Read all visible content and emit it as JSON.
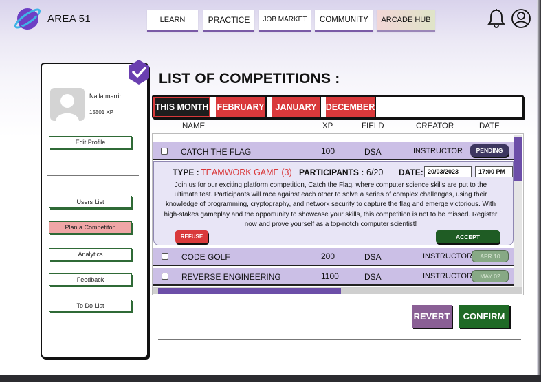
{
  "header": {
    "brand": "AREA 51",
    "nav": [
      "LEARN",
      "PRACTICE",
      "JOB MARKET",
      "COMMUNITY",
      "ARCADE HUB"
    ]
  },
  "sidebar": {
    "profile": {
      "name": "Naila marrir",
      "xp": "15501 XP"
    },
    "edit_profile": "Edit Profile",
    "items": [
      "Users List",
      "Plan a Competiton",
      "Analytics",
      "Feedback",
      "To Do List"
    ],
    "active_item": "Plan a Competiton"
  },
  "main": {
    "title": "LIST OF COMPETITIONS :",
    "tabs": [
      "THIS MONTH",
      "FEBRUARY",
      "JANUARY",
      "DECEMBER"
    ],
    "active_tab": "THIS MONTH",
    "columns": [
      "NAME",
      "XP",
      "FIELD",
      "CREATOR",
      "DATE"
    ],
    "rows": [
      {
        "name": "CATCH THE FLAG",
        "xp": "100",
        "field": "DSA",
        "creator": "INSTRUCTOR",
        "date": "PENDING"
      },
      {
        "name": "CODE GOLF",
        "xp": "200",
        "field": "DSA",
        "creator": "INSTRUCTOR",
        "date": "APR 10"
      },
      {
        "name": "REVERSE ENGINEERING",
        "xp": "1100",
        "field": "DSA",
        "creator": "INSTRUCTOR",
        "date": "MAY 02"
      }
    ],
    "detail": {
      "type_label": "TYPE :",
      "type_value": "TEAMWORK GAME (3)",
      "participants_label": "PARTICIPANTS :",
      "participants_value": "6/20",
      "date_label": "DATE:",
      "date_value": "20/03/2023",
      "time_value": "17:00   PM",
      "description": "Join us for our exciting platform competition, Catch the Flag, where computer science skills are put to the ultimate test. Participants will race against each other to solve a series of complex challenges, using their knowledge of programming, cryptography, and network security to capture the flag and emerge victorious. With high-stakes gameplay and the opportunity to showcase your skills, this competition is not to be missed. Register now and prove yourself as a top-notch computer scientist!",
      "refuse_label": "REFUSE",
      "accept_label": "ACCEPT"
    },
    "revert_label": "REVERT",
    "confirm_label": "CONFIRM"
  },
  "colors": {
    "accent_purple": "#6c4ea8",
    "red": "#d9393b",
    "green": "#1f6a26",
    "row_purple": "#cbbfe6"
  }
}
